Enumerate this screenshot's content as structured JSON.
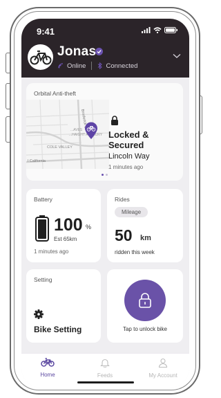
{
  "status_bar": {
    "time": "9:41"
  },
  "header": {
    "user_name": "Jonas",
    "online_label": "Online",
    "connected_label": "Connected"
  },
  "anti_theft": {
    "title": "Orbital Anti-theft",
    "lock_status": "Locked & Secured",
    "location": "Lincoln Way",
    "time_ago": "1 minutes ago",
    "map_labels": {
      "street": "Broderick St",
      "area1": "...AVES",
      "area2": "...HAIGHT ASHBURY",
      "area3": "COLE VALLEY",
      "area4": "l California"
    }
  },
  "battery": {
    "title": "Battery",
    "value": "100",
    "unit": "%",
    "estimate": "Est 65km",
    "time_ago": "1 minutes ago",
    "level_percent": 100
  },
  "rides": {
    "title": "Rides",
    "pill": "Mileage",
    "value": "50",
    "unit": "km",
    "subtitle": "ridden this week"
  },
  "setting": {
    "title": "Setting",
    "label": "Bike Setting"
  },
  "unlock": {
    "label": "Tap to unlock bike"
  },
  "nav": {
    "home": "Home",
    "feeds": "Feeds",
    "account": "My Account"
  },
  "colors": {
    "header_bg": "#2b2429",
    "accent": "#6a52a8",
    "screen_bg": "#efeef1"
  },
  "icons": [
    "signal-icon",
    "wifi-icon",
    "battery-icon",
    "verified-icon",
    "bluetooth-icon",
    "chevron-down-icon",
    "map-pin-icon",
    "lock-icon",
    "gear-icon",
    "unlock-icon",
    "bike-icon",
    "bell-icon",
    "user-icon"
  ]
}
